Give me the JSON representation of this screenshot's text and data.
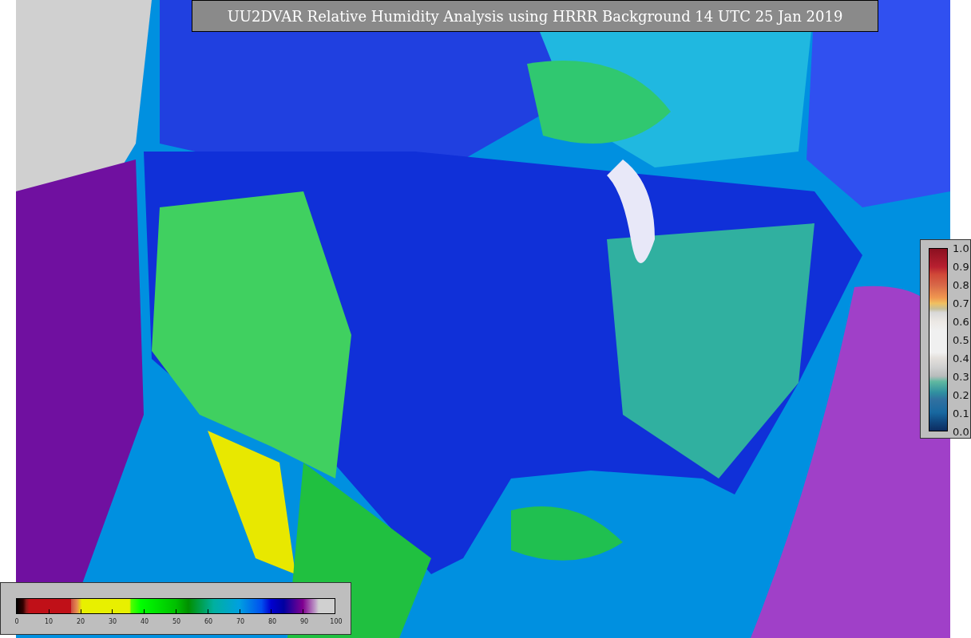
{
  "title": "UU2DVAR Relative Humidity Analysis using HRRR Background 14 UTC 25 Jan 2019",
  "humidity_colorbar": {
    "ticks": [
      "0",
      "10",
      "20",
      "30",
      "40",
      "50",
      "60",
      "70",
      "80",
      "90",
      "100"
    ]
  },
  "ratio_colorbar": {
    "ticks": [
      "1.0",
      "0.9",
      "0.8",
      "0.7",
      "0.6",
      "0.5",
      "0.4",
      "0.3",
      "0.2",
      "0.1",
      "0.0"
    ]
  }
}
